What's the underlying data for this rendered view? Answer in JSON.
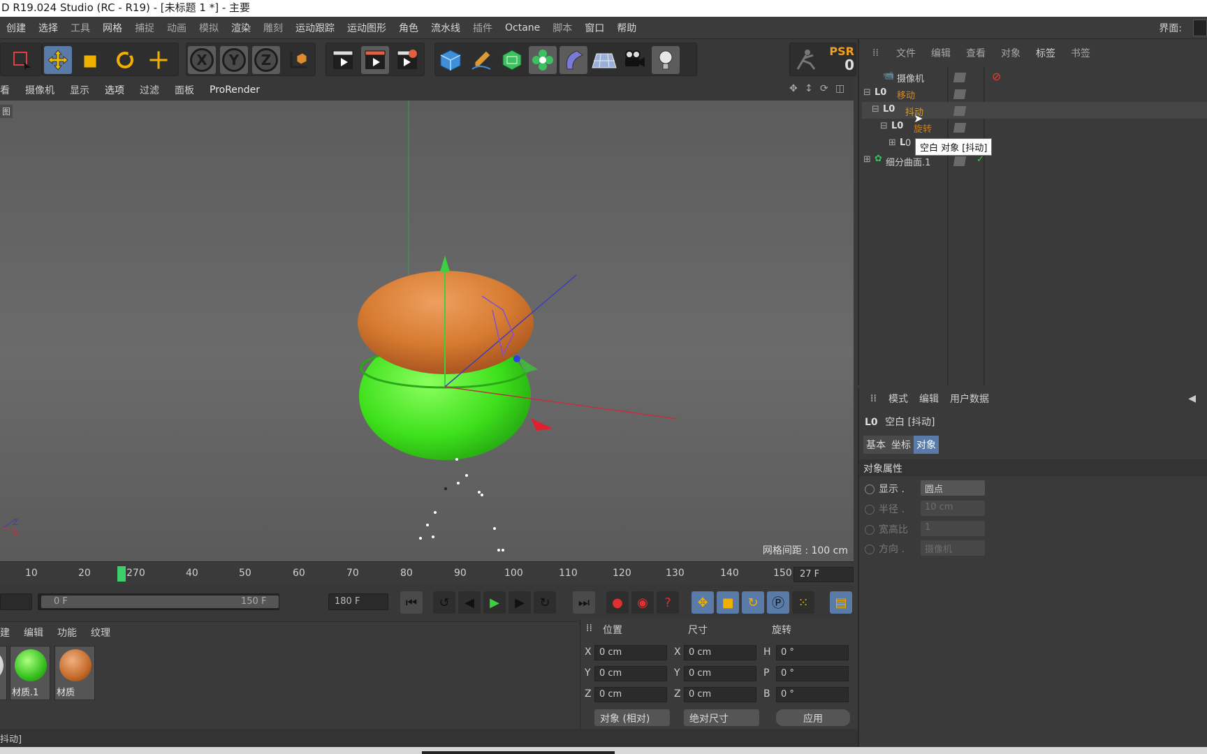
{
  "window": {
    "title": "D R19.024 Studio (RC - R19) - [未标题 1 *] - 主要",
    "ui_label": "界面:"
  },
  "menubar": [
    "创建",
    "选择",
    "工具",
    "网格",
    "捕捉",
    "动画",
    "模拟",
    "渲染",
    "雕刻",
    "运动跟踪",
    "运动图形",
    "角色",
    "流水线",
    "插件",
    "Octane",
    "脚本",
    "窗口",
    "帮助"
  ],
  "toolbar": {
    "axes": [
      "X",
      "Y",
      "Z"
    ],
    "psr_label": "PSR",
    "psr_value": "0"
  },
  "viewport_menu": [
    "看",
    "摄像机",
    "显示",
    "选项",
    "过滤",
    "面板",
    "ProRender"
  ],
  "viewport": {
    "tag": "图",
    "grid_spacing": "网格间距 : 100 cm"
  },
  "timeline": {
    "ticks": [
      "10",
      "20",
      "270",
      "40",
      "50",
      "60",
      "70",
      "80",
      "90",
      "100",
      "110",
      "120",
      "130",
      "140",
      "150"
    ],
    "current_frame": "27 F"
  },
  "transport": {
    "range_start": "0 F",
    "range_end": "150 F",
    "max_frame": "180 F"
  },
  "materials": {
    "menu": [
      "建",
      "编辑",
      "功能",
      "纹理"
    ],
    "items": [
      {
        "label": "材质.1",
        "color": "#36c01f"
      },
      {
        "label": "材质",
        "color": "#c56a2a"
      }
    ]
  },
  "coordinates": {
    "headers": [
      "位置",
      "尺寸",
      "旋转"
    ],
    "rows": [
      {
        "pos_axis": "X",
        "pos": "0 cm",
        "size_axis": "X",
        "size": "0 cm",
        "rot_axis": "H",
        "rot": "0 °"
      },
      {
        "pos_axis": "Y",
        "pos": "0 cm",
        "size_axis": "Y",
        "size": "0 cm",
        "rot_axis": "P",
        "rot": "0 °"
      },
      {
        "pos_axis": "Z",
        "pos": "0 cm",
        "size_axis": "Z",
        "size": "0 cm",
        "rot_axis": "B",
        "rot": "0 °"
      }
    ],
    "mode_dropdown": "对象 (相对)",
    "size_dropdown": "绝对尺寸",
    "apply_button": "应用"
  },
  "status_bar": "抖动]",
  "object_manager": {
    "menu": [
      "文件",
      "编辑",
      "查看",
      "对象",
      "标签",
      "书签"
    ],
    "objects": [
      {
        "name": "摄像机",
        "color": "#cfcfcf"
      },
      {
        "name": "移动",
        "color": "#d38a2a"
      },
      {
        "name": "抖动",
        "color": "#e09a2a"
      },
      {
        "name": "旋转",
        "color": "#c7802a"
      },
      {
        "name": "0",
        "color": "#cfcfcf"
      },
      {
        "name": "细分曲面.1",
        "color": "#cfcfcf"
      }
    ],
    "tooltip": "空白 对象 [抖动]"
  },
  "attribute_manager": {
    "menu": [
      "模式",
      "编辑",
      "用户数据"
    ],
    "object_title": "空白 [抖动]",
    "tabs": [
      "基本",
      "坐标",
      "对象"
    ],
    "section": "对象属性",
    "props": [
      {
        "label": "显示 .",
        "value": "圆点",
        "enabled": true
      },
      {
        "label": "半径 .",
        "value": "10 cm",
        "enabled": false
      },
      {
        "label": "宽高比",
        "value": "1",
        "enabled": false
      },
      {
        "label": "方向 .",
        "value": "摄像机",
        "enabled": false
      }
    ]
  }
}
